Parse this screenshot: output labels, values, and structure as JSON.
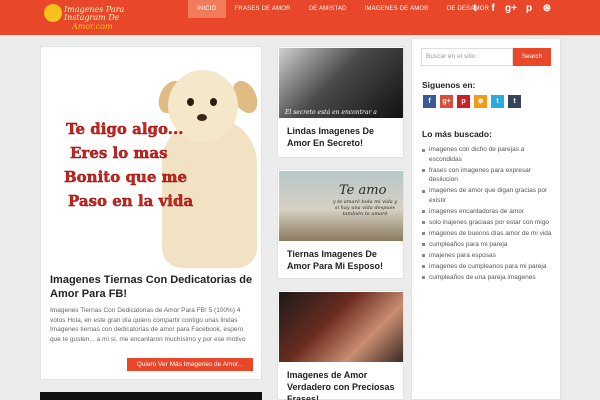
{
  "logo": {
    "line1": "Imagenes Para",
    "line2": "Instagram De",
    "line3": "Amor.com"
  },
  "nav": {
    "items": [
      {
        "label": "INICIO",
        "active": true
      },
      {
        "label": "FRASES DE AMOR",
        "active": false
      },
      {
        "label": "DE AMISTAD",
        "active": false
      },
      {
        "label": "IMAGENES DE AMOR",
        "active": false
      },
      {
        "label": "DE DESAMOR",
        "active": false
      }
    ],
    "social_icons": [
      {
        "name": "twitter-icon",
        "glyph": "t"
      },
      {
        "name": "facebook-icon",
        "glyph": "f"
      },
      {
        "name": "googleplus-icon",
        "glyph": "g+"
      },
      {
        "name": "pinterest-icon",
        "glyph": "p"
      },
      {
        "name": "rss-icon",
        "glyph": "⊛"
      }
    ],
    "bar_color": "#e8472a"
  },
  "main_post": {
    "image_text": [
      "Te digo algo...",
      "Eres lo mas",
      "Bonito que me",
      "Paso en la vida"
    ],
    "title": "Imagenes Tiernas Con Dedicatorias de Amor Para FB!",
    "excerpt": "Imagenes Tiernas Con Dedicatorias de Amor Para FB! 5 (100%) 4 votos Hola, en este gran día quiero compartir contigo unas lindas Imagenes tiernas con dedicatorias de amor para Facebook, espero que te gusten... a mi sí, me encantaron muchísimo y por ese motivo",
    "read_more": "Quiero Ver Más Imagenes de Amor..."
  },
  "mid_posts": [
    {
      "title": "Lindas Imagenes De Amor En Secreto!",
      "overlay": "El secreto está en encontrar a"
    },
    {
      "title": "Tiernas Imagenes De Amor Para Mi Esposo!",
      "image_heading": "Te amo",
      "image_sub": "y te amaré toda mi vida y si hay una vida después también te amaré"
    },
    {
      "title": "Imagenes de Amor Verdadero con Preciosas Frases!"
    }
  ],
  "sidebar": {
    "search_placeholder": "Buscar en el sitio",
    "search_button": "Search",
    "follow_heading": "Siguenos en:",
    "follow_icons": [
      {
        "name": "facebook-icon",
        "glyph": "f",
        "color": "#3b5998"
      },
      {
        "name": "googleplus-icon",
        "glyph": "g+",
        "color": "#dd4b39"
      },
      {
        "name": "pinterest-icon",
        "glyph": "p",
        "color": "#cb2027"
      },
      {
        "name": "rss-icon",
        "glyph": "⊛",
        "color": "#f39c12"
      },
      {
        "name": "twitter-icon",
        "glyph": "t",
        "color": "#2ba9e1"
      },
      {
        "name": "tumblr-icon",
        "glyph": "t",
        "color": "#35465c"
      }
    ],
    "popular_heading": "Lo más buscado:",
    "popular": [
      "imagenes con dicho de parejas a escondidas",
      "frases con imagenes para expresar desilucion",
      "imagenes de amor que digan gracias por existir",
      "imagenes encantadoras de amor",
      "solo inajenes graciaas por estar con migo",
      "imagenes de buenos días amor de mi vida",
      "cumpleaños para mi pareja",
      "imajenes para esposas",
      "imagenes de cumpleanos para mi pareja",
      "cumpleaños de una pareja imagenes"
    ]
  }
}
